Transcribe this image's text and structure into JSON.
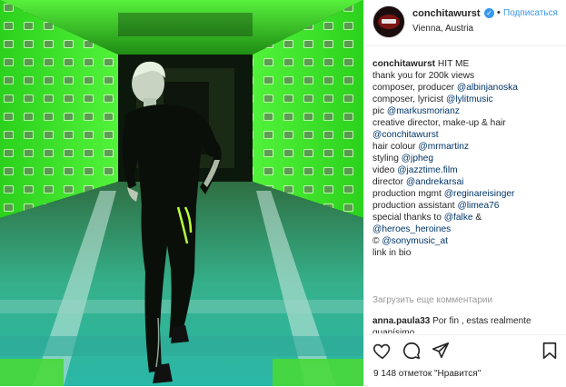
{
  "post": {
    "username": "conchitawurst",
    "follow_label": "Подписаться",
    "separator": "•",
    "verified_glyph": "✓",
    "location": "Vienna, Austria",
    "media_alt": "Photo of man in black athletic wear walking through a green illuminated tunnel"
  },
  "caption": {
    "author": "conchitawurst",
    "first_line": "HIT ME",
    "lines": [
      {
        "text": "thank you for 200k views",
        "mention": ""
      },
      {
        "text": "composer, producer ",
        "mention": "@albinjanoska"
      },
      {
        "text": "composer, lyricist ",
        "mention": "@lylitmusic"
      },
      {
        "text": "pic ",
        "mention": "@markusmorianz"
      },
      {
        "text": "creative director, make-up & hair",
        "mention": ""
      },
      {
        "text": "",
        "mention": "@conchitawurst"
      },
      {
        "text": "hair colour ",
        "mention": "@mrmartinz"
      },
      {
        "text": "styling ",
        "mention": "@jpheg"
      },
      {
        "text": "video ",
        "mention": "@jazztime.film"
      },
      {
        "text": "director ",
        "mention": "@andrekarsai"
      },
      {
        "text": "production mgmt ",
        "mention": "@reginareisinger"
      },
      {
        "text": "production assistant ",
        "mention": "@limea76"
      },
      {
        "text": "special thanks to ",
        "mention": "@falke",
        "suffix": " &"
      },
      {
        "text": "",
        "mention": "@heroes_heroines"
      },
      {
        "text": "© ",
        "mention": "@sonymusic_at"
      },
      {
        "text": "link in bio",
        "mention": ""
      }
    ]
  },
  "comments": {
    "load_more": "Загрузить еще комментарии",
    "items": [
      {
        "user": "anna.paula33",
        "text": "Por fin , estas realmente guapísimo"
      }
    ]
  },
  "actions": {
    "icons": [
      "heart-icon",
      "comment-icon",
      "share-icon",
      "bookmark-icon"
    ],
    "likes_text": "9 148 отметок \"Нравится\""
  },
  "colors": {
    "accent": "#3897f0",
    "mention": "#003569",
    "tunnel_green": "#3fe02a",
    "muted": "#999999"
  }
}
